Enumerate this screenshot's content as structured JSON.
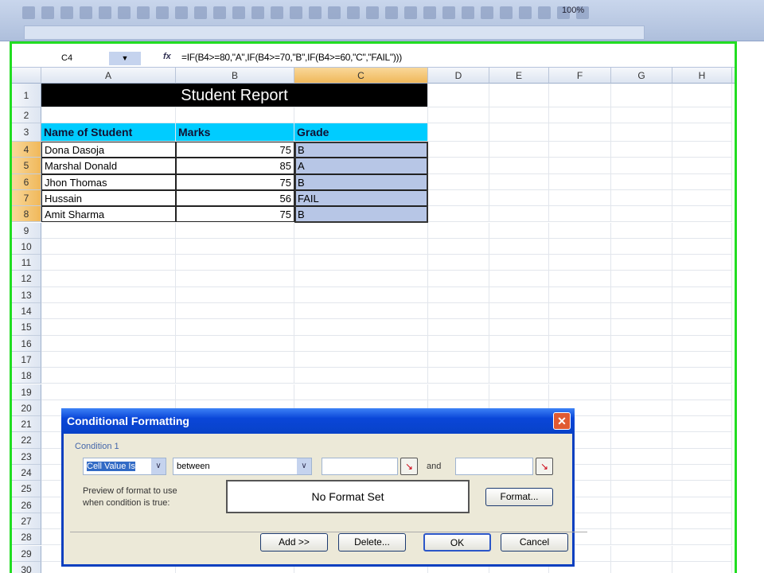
{
  "toolbar": {
    "zoom": "100%"
  },
  "formula_bar": {
    "name_box": "C4",
    "fx": "fx",
    "formula": "=IF(B4>=80,\"A\",IF(B4>=70,\"B\",IF(B4>=60,\"C\",\"FAIL\")))"
  },
  "sheet": {
    "columns": [
      "A",
      "B",
      "C",
      "D",
      "E",
      "F",
      "G",
      "H"
    ],
    "selected_column": "C",
    "title": "Student Report",
    "headers": [
      "Name of Student",
      "Marks",
      "Grade"
    ],
    "rows": [
      {
        "name": "Dona Dasoja",
        "marks": "75",
        "grade": "B"
      },
      {
        "name": "Marshal Donald",
        "marks": "85",
        "grade": "A"
      },
      {
        "name": "Jhon Thomas",
        "marks": "75",
        "grade": "B"
      },
      {
        "name": "Hussain",
        "marks": "56",
        "grade": "FAIL"
      },
      {
        "name": "Amit Sharma",
        "marks": "75",
        "grade": "B"
      }
    ],
    "row_count": 30,
    "header_color": "#00ccff",
    "title_bg": "#000000"
  },
  "dialog": {
    "title": "Conditional Formatting",
    "condition_label": "Condition 1",
    "type_select": "Cell Value Is",
    "operator_select": "between",
    "value1": "",
    "and_label": "and",
    "value2": "",
    "preview_label_1": "Preview of format to use",
    "preview_label_2": "when condition is true:",
    "preview_text": "No Format Set",
    "format_button": "Format...",
    "add_button": "Add >>",
    "delete_button": "Delete...",
    "ok_button": "OK",
    "cancel_button": "Cancel",
    "close": "✕"
  }
}
